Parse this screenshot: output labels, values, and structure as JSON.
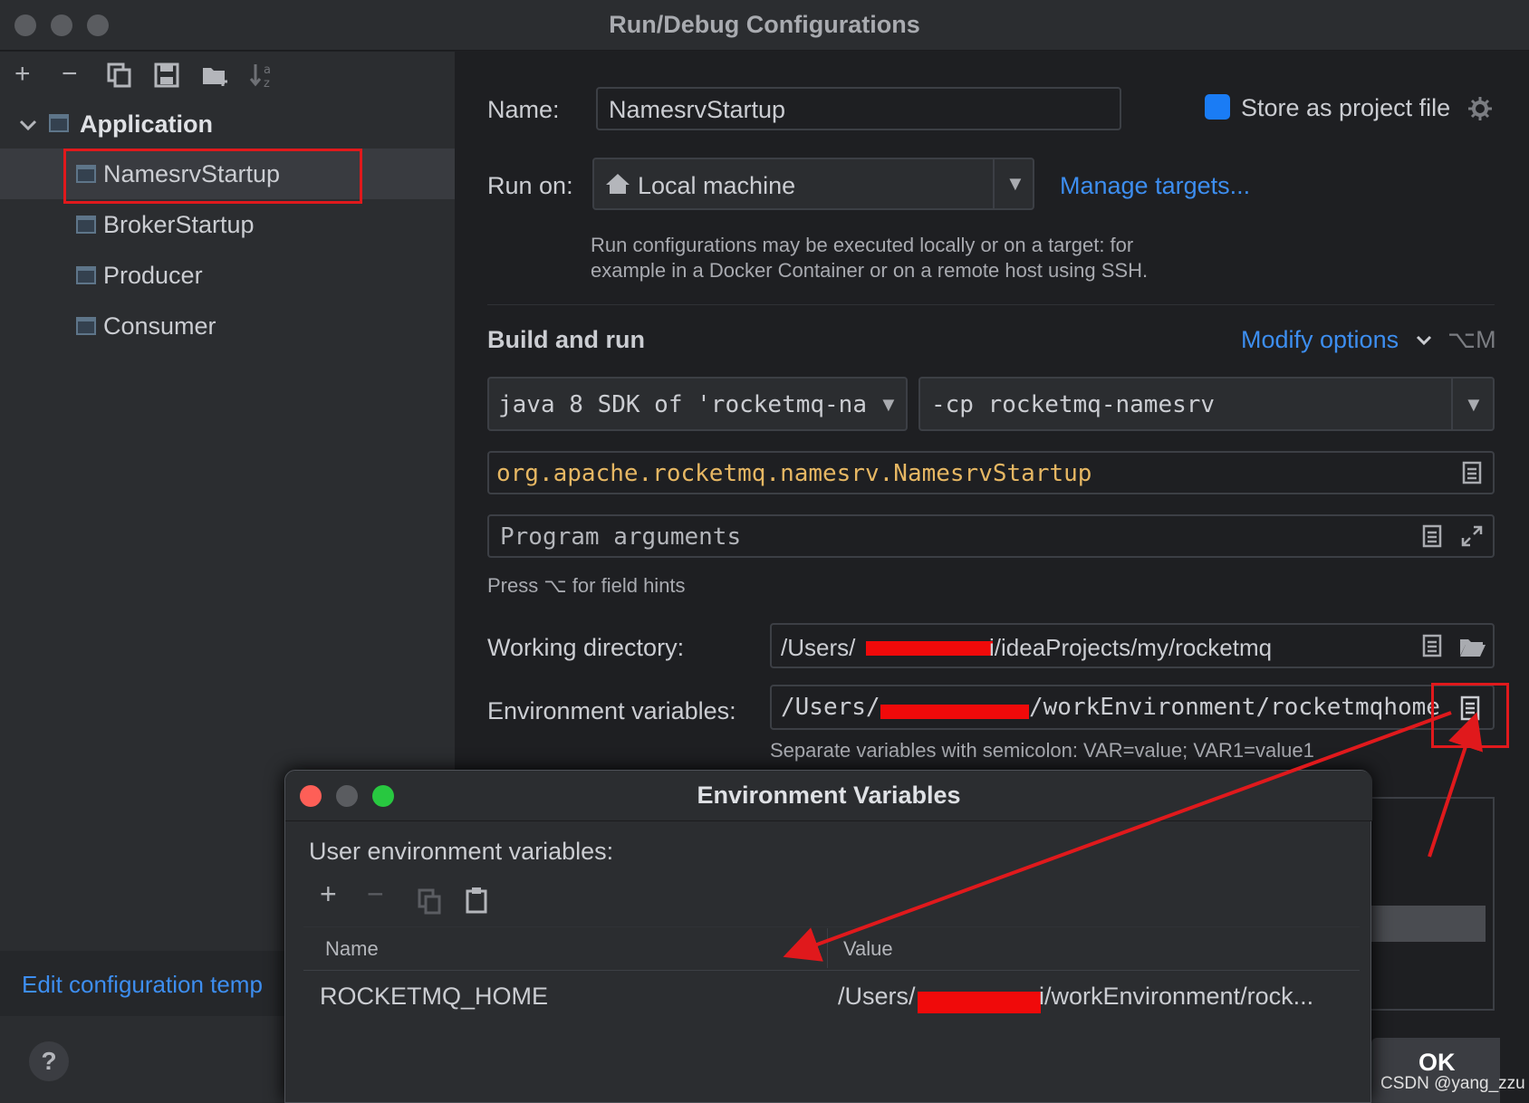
{
  "window": {
    "title": "Run/Debug Configurations"
  },
  "toolbar": {
    "icons": [
      "add-icon",
      "remove-icon",
      "copy-icon",
      "save-icon",
      "new-folder-icon",
      "sort-icon"
    ]
  },
  "tree": {
    "group": "Application",
    "items": [
      "NamesrvStartup",
      "BrokerStartup",
      "Producer",
      "Consumer"
    ],
    "selected": "NamesrvStartup"
  },
  "sidebar": {
    "edit_templates": "Edit configuration temp",
    "help": "?"
  },
  "form": {
    "name_label": "Name:",
    "name_value": "NamesrvStartup",
    "store_label": "Store as project file",
    "run_on_label": "Run on:",
    "run_on_value": "Local machine",
    "manage_targets": "Manage targets...",
    "run_hint_1": "Run configurations may be executed locally or on a target: for",
    "run_hint_2": "example in a Docker Container or on a remote host using SSH.",
    "build_run": "Build and run",
    "modify_options": "Modify options",
    "modify_shortcut": "⌥M",
    "sdk": "java 8 SDK of 'rocketmq-na",
    "cp": "-cp rocketmq-namesrv",
    "main_class": "org.apache.rocketmq.namesrv.NamesrvStartup",
    "program_args_placeholder": "Program arguments",
    "field_hints": "Press ⌥ for field hints",
    "workdir_label": "Working directory:",
    "workdir_prefix": "/Users/",
    "workdir_suffix": "i/ideaProjects/my/rocketmq",
    "env_label": "Environment variables:",
    "env_prefix": "/Users/",
    "env_suffix": "/workEnvironment/rocketmqhome",
    "env_hint": "Separate variables with semicolon: VAR=value; VAR1=value1"
  },
  "popup": {
    "title": "Environment Variables",
    "section": "User environment variables:",
    "columns": [
      "Name",
      "Value"
    ],
    "rows": [
      {
        "name": "ROCKETMQ_HOME",
        "value_prefix": "/Users/",
        "value_suffix": "i/workEnvironment/rock..."
      }
    ]
  },
  "footer": {
    "ok": "OK",
    "watermark": "CSDN @yang_zzu"
  },
  "colors": {
    "accent": "#3d8ef0",
    "annotation": "#e0191c",
    "class_text": "#e6b763"
  }
}
